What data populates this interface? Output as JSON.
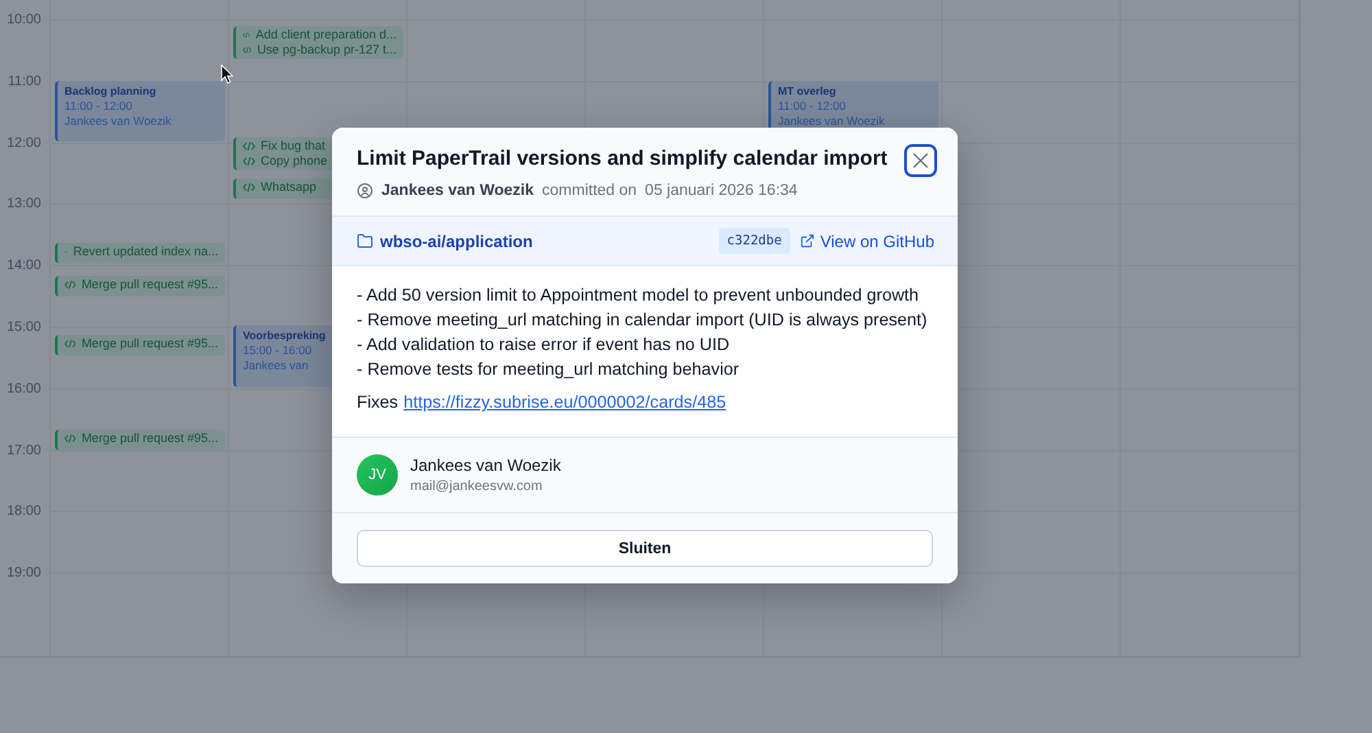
{
  "calendar": {
    "hours": [
      "10:00",
      "11:00",
      "12:00",
      "13:00",
      "14:00",
      "15:00",
      "16:00",
      "17:00",
      "18:00",
      "19:00"
    ],
    "days": [
      {
        "events": [
          {
            "kind": "meeting",
            "title": "Backlog planning",
            "time": "11:00 - 12:00",
            "person": "Jankees van Woezik"
          },
          {
            "kind": "commit",
            "messages": [
              "Revert updated index na..."
            ]
          },
          {
            "kind": "commit",
            "messages": [
              "Merge pull request #95..."
            ]
          },
          {
            "kind": "commit",
            "messages": [
              "Merge pull request #95..."
            ]
          },
          {
            "kind": "commit",
            "messages": [
              "Merge pull request #95..."
            ]
          }
        ]
      },
      {
        "events": [
          {
            "kind": "commit",
            "messages": [
              "Add client preparation d...",
              "Use pg-backup pr-127 t..."
            ]
          },
          {
            "kind": "commit",
            "messages": [
              "Fix bug that",
              "Copy phone"
            ]
          },
          {
            "kind": "commit",
            "messages": [
              "Whatsapp"
            ]
          },
          {
            "kind": "meeting",
            "title": "Voorbespreking",
            "time": "15:00 - 16:00",
            "person": "Jankees van"
          }
        ]
      },
      {
        "events": [
          {
            "kind": "meeting",
            "title": "MT overleg",
            "time": "11:00 - 12:00",
            "person": "Jankees van Woezik"
          }
        ]
      }
    ]
  },
  "dialog": {
    "title": "Limit PaperTrail versions and simplify calendar import",
    "author": "Jankees van Woezik",
    "committed_label": "committed on",
    "date": "05 januari 2026 16:34",
    "repository": "wbso-ai/application",
    "sha": "c322dbe",
    "github_link": "View on GitHub",
    "message_lines": [
      "- Add 50 version limit to Appointment model to prevent unbounded growth",
      "- Remove meeting_url matching in calendar import (UID is always present)",
      "- Add validation to raise error if event has no UID",
      "- Remove tests for meeting_url matching behavior"
    ],
    "fixes_label": "Fixes",
    "fixes_url": "https://fizzy.subrise.eu/0000002/cards/485",
    "committer": {
      "initials": "JV",
      "name": "Jankees van Woezik",
      "email": "mail@jankeesvw.com"
    },
    "close_button": "Sluiten"
  }
}
